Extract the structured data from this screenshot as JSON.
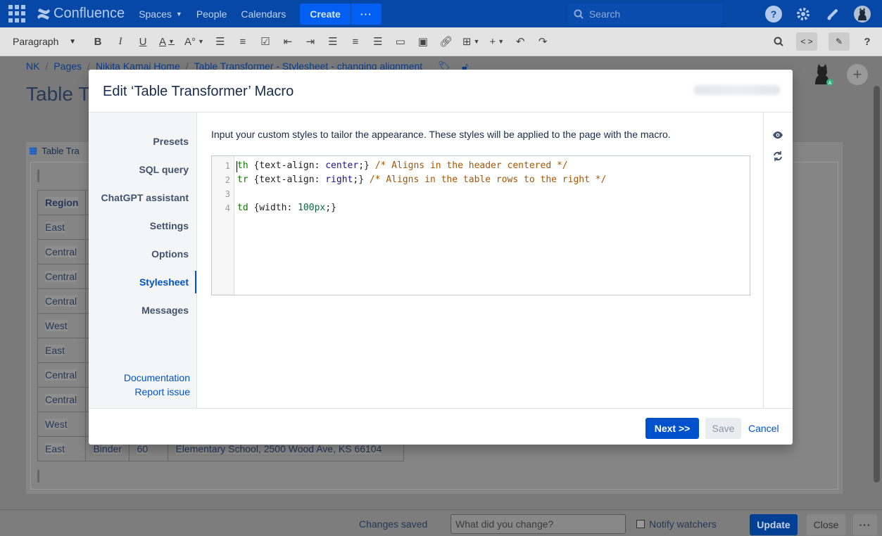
{
  "topnav": {
    "brand": "Confluence",
    "links": [
      "Spaces",
      "People",
      "Calendars"
    ],
    "create_label": "Create",
    "more_label": "···",
    "search_placeholder": "Search"
  },
  "toolbar": {
    "paragraph_label": "Paragraph",
    "help_label": "?"
  },
  "breadcrumb": [
    "NK",
    "Pages",
    "Nikita Kamai Home",
    "Table Transformer - Stylesheet - changing alignment"
  ],
  "page_title": "Table Tr",
  "macro_label": "Table Tra",
  "bg_table": {
    "header": "Region",
    "rows": [
      "East",
      "Central",
      "Central",
      "Central",
      "West",
      "East",
      "Central",
      "Central",
      "West",
      "East"
    ],
    "last_row": [
      "Binder",
      "60",
      "Elementary School, 2500 Wood Ave, KS 66104"
    ]
  },
  "bottombar": {
    "status": "Changes saved",
    "change_placeholder": "What did you change?",
    "notify_label": "Notify watchers",
    "update_label": "Update",
    "close_label": "Close",
    "more_label": "···"
  },
  "modal": {
    "title": "Edit ‘Table Transformer’ Macro",
    "nav": [
      "Presets",
      "SQL query",
      "ChatGPT assistant",
      "Settings",
      "Options",
      "Stylesheet",
      "Messages"
    ],
    "active_nav": "Stylesheet",
    "links": [
      "Documentation",
      "Report issue"
    ],
    "description": "Input your custom styles to tailor the appearance. These styles will be applied to the page with the macro.",
    "code_lines": [
      {
        "n": "1",
        "tag": "th",
        "prop": " {text-align: ",
        "val": "center",
        "end": ";} ",
        "comment": "/* Aligns in the header centered */"
      },
      {
        "n": "2",
        "tag": "tr",
        "prop": " {text-align: ",
        "val": "right",
        "end": ";} ",
        "comment": "/* Aligns in the table rows to the right */"
      },
      {
        "n": "3",
        "tag": "",
        "prop": "",
        "val": "",
        "end": "",
        "comment": ""
      },
      {
        "n": "4",
        "tag": "td",
        "prop": " {width: ",
        "val": "100px",
        "end": ";}",
        "comment": ""
      }
    ],
    "next_label": "Next >>",
    "save_label": "Save",
    "cancel_label": "Cancel"
  }
}
